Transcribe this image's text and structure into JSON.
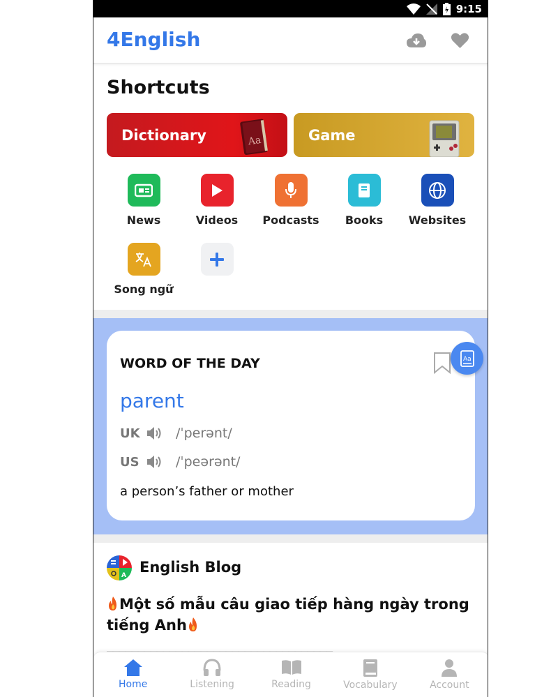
{
  "status_bar": {
    "time": "9:15"
  },
  "app_bar": {
    "title": "4English"
  },
  "shortcuts": {
    "title": "Shortcuts",
    "dictionary_label": "Dictionary",
    "game_label": "Game",
    "items": [
      {
        "label": "News",
        "color": "#1fba5a"
      },
      {
        "label": "Videos",
        "color": "#e8232c"
      },
      {
        "label": "Podcasts",
        "color": "#ef7133"
      },
      {
        "label": "Books",
        "color": "#2bbcd6"
      },
      {
        "label": "Websites",
        "color": "#1a4fb8"
      },
      {
        "label": "Song ngữ",
        "color": "#e4a520"
      }
    ]
  },
  "word_of_the_day": {
    "heading": "WORD OF THE DAY",
    "word": "parent",
    "uk_label": "UK",
    "uk_ipa": "/ˈperənt/",
    "us_label": "US",
    "us_ipa": "/ˈpeərənt/",
    "definition": "a person’s father or mother"
  },
  "blog": {
    "title": "English Blog",
    "post_title": "Một số mẫu câu giao tiếp hàng ngày trong tiếng Anh",
    "separator": "____________________________________"
  },
  "bottom_nav": {
    "tabs": [
      "Home",
      "Listening",
      "Reading",
      "Vocabulary",
      "Account"
    ],
    "active": "Home",
    "active_color": "#3478e8"
  },
  "colors": {
    "brand": "#3478e8",
    "wotd_background": "#a5bff6"
  }
}
